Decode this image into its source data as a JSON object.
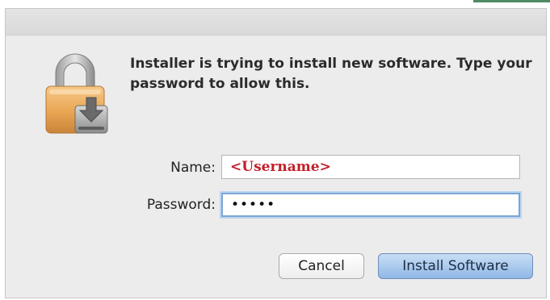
{
  "dialog": {
    "message": "Installer is trying to install new software. Type your password to allow this.",
    "icon": "lock-download-icon"
  },
  "form": {
    "name_label": "Name:",
    "name_value": "<Username>",
    "password_label": "Password:",
    "password_value": "•••••"
  },
  "buttons": {
    "cancel_label": "Cancel",
    "install_label": "Install Software"
  },
  "colors": {
    "username_text": "#c21f2b",
    "default_button": "#a9c8ec",
    "focus_ring": "#7aa6d6"
  }
}
